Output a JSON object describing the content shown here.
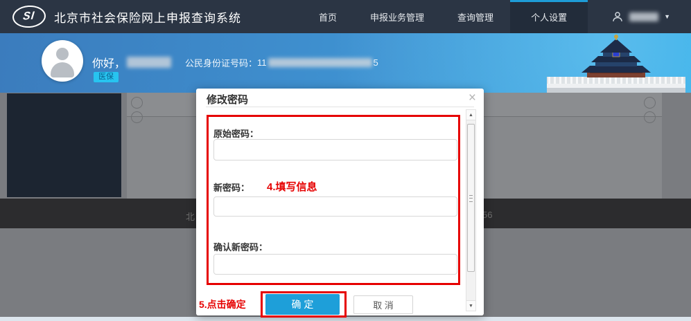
{
  "app": {
    "title": "北京市社会保险网上申报查询系统",
    "logo_text": "SI"
  },
  "nav": {
    "items": [
      {
        "label": "首页",
        "active": false
      },
      {
        "label": "申报业务管理",
        "active": false
      },
      {
        "label": "查询管理",
        "active": false
      },
      {
        "label": "个人设置",
        "active": true
      }
    ],
    "user_caret": "▼"
  },
  "hero": {
    "greeting": "你好，",
    "id_label": "公民身份证号码：",
    "id_visible_prefix": "11",
    "id_visible_suffix": "5",
    "badge": "医保"
  },
  "modal": {
    "title": "修改密码",
    "close_glyph": "×",
    "fields": [
      {
        "label": "原始密码："
      },
      {
        "label": "新密码："
      },
      {
        "label": "确认新密码："
      }
    ],
    "confirm_label": "确 定",
    "cancel_label": "取 消",
    "scrollbar": {
      "up_glyph": "▲",
      "down_glyph": "▼"
    }
  },
  "annotations": {
    "step4": "4.填写信息",
    "step5": "5.点击确定"
  },
  "footer": {
    "left_fragment": "北",
    "right_fragment": "56"
  },
  "colors": {
    "topbar": "#2b3544",
    "active_tab_bg": "#222c3a",
    "active_tab_underline": "#1e9cd7",
    "hero_gradient_start": "#3b7cbd",
    "hero_gradient_end": "#2ba7e3",
    "badge_bg": "#27c4f0",
    "annotation_red": "#e60000",
    "confirm_blue": "#1e9fd9",
    "footer_bar": "#2c2c2e"
  }
}
